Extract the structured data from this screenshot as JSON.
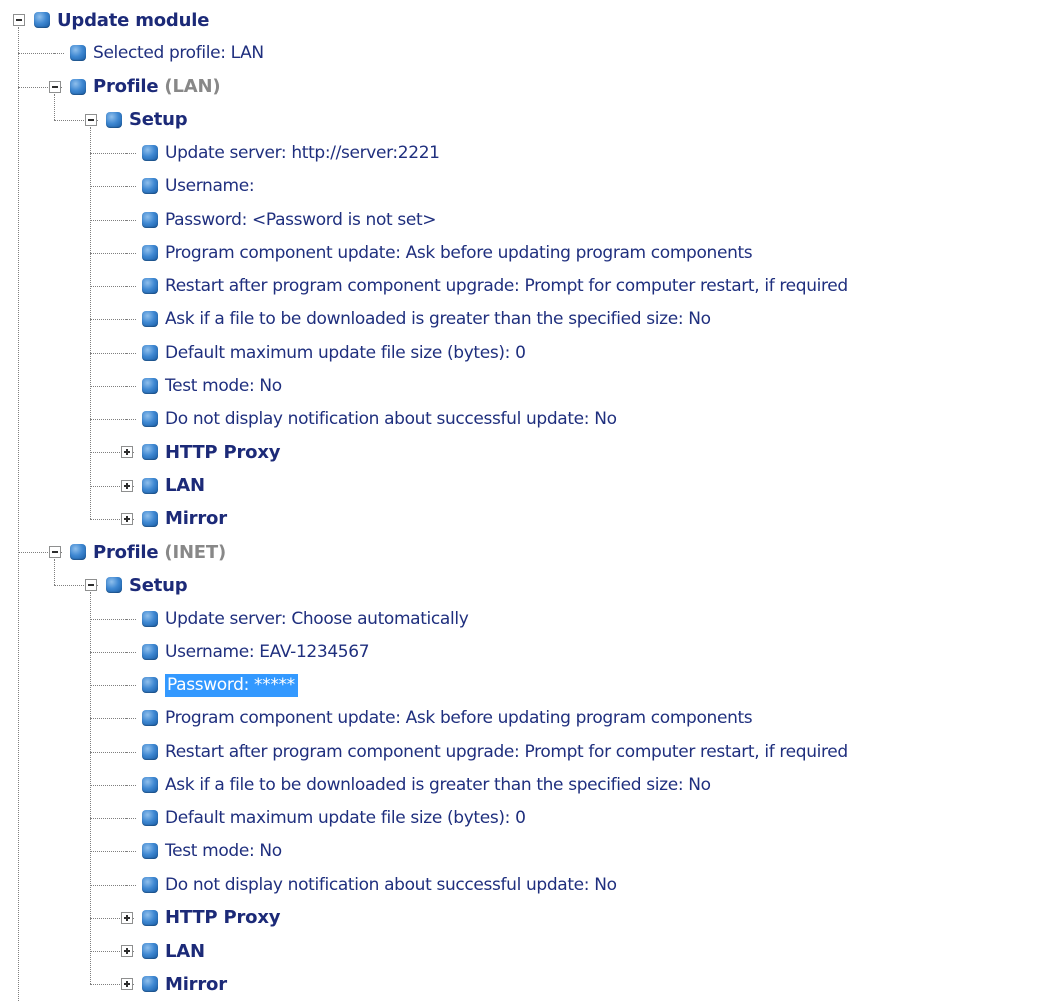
{
  "tree": {
    "root": {
      "label": "Update module",
      "children": [
        {
          "label": "Selected profile: LAN"
        },
        {
          "label": "Profile",
          "suffix": "(LAN)",
          "expanded": true,
          "children": [
            {
              "label": "Setup",
              "expanded": true,
              "children": [
                {
                  "label": "Update server: http://server:2221"
                },
                {
                  "label": "Username:"
                },
                {
                  "label": "Password: <Password is not set>"
                },
                {
                  "label": "Program component update: Ask before updating program components"
                },
                {
                  "label": "Restart after program component upgrade: Prompt for computer restart, if required"
                },
                {
                  "label": "Ask if a file to be downloaded is greater than the specified size: No"
                },
                {
                  "label": "Default maximum update file size (bytes): 0"
                },
                {
                  "label": "Test mode: No"
                },
                {
                  "label": "Do not display notification about successful update: No"
                },
                {
                  "label": "HTTP Proxy",
                  "expanded": false
                },
                {
                  "label": "LAN",
                  "expanded": false
                },
                {
                  "label": "Mirror",
                  "expanded": false
                }
              ]
            }
          ]
        },
        {
          "label": "Profile",
          "suffix": "(INET)",
          "expanded": true,
          "children": [
            {
              "label": "Setup",
              "expanded": true,
              "children": [
                {
                  "label": "Update server: Choose automatically"
                },
                {
                  "label": "Username: EAV-1234567"
                },
                {
                  "label": "Password: *****",
                  "selected": true
                },
                {
                  "label": "Program component update: Ask before updating program components"
                },
                {
                  "label": "Restart after program component upgrade: Prompt for computer restart, if required"
                },
                {
                  "label": "Ask if a file to be downloaded is greater than the specified size: No"
                },
                {
                  "label": "Default maximum update file size (bytes): 0"
                },
                {
                  "label": "Test mode: No"
                },
                {
                  "label": "Do not display notification about successful update: No"
                },
                {
                  "label": "HTTP Proxy",
                  "expanded": false
                },
                {
                  "label": "LAN",
                  "expanded": false
                },
                {
                  "label": "Mirror",
                  "expanded": false
                }
              ]
            }
          ]
        }
      ]
    }
  },
  "colors": {
    "text": "#1f2f7e",
    "suffix": "#888888",
    "selection": "#3399ff",
    "connector": "#7f7f7f",
    "bullet": "#3f88d2"
  },
  "icons": {
    "bullet": "blue-bullet-icon",
    "expanded": "minus-box-icon",
    "collapsed": "plus-box-icon"
  }
}
